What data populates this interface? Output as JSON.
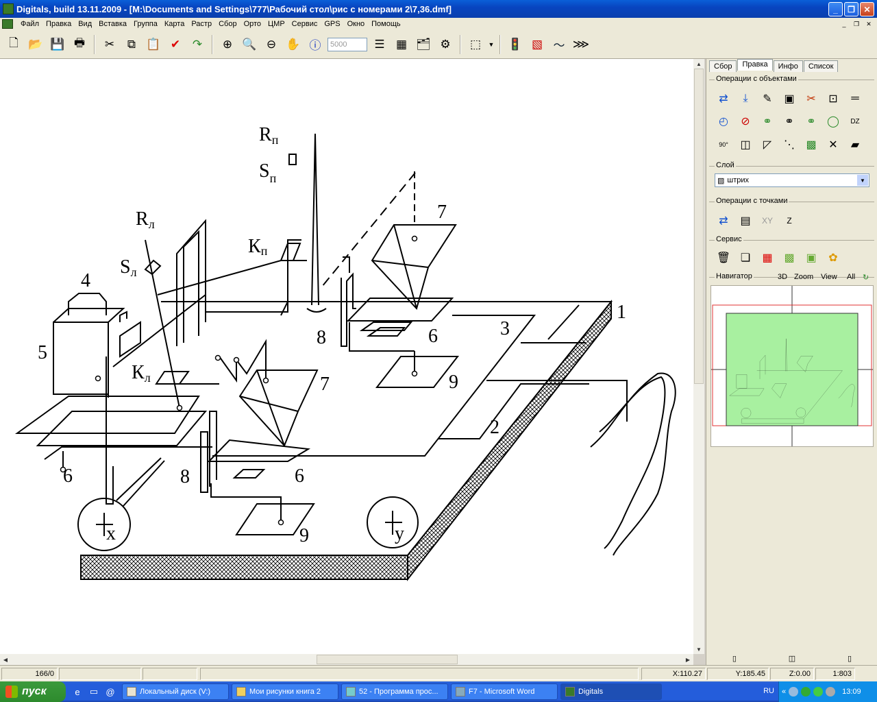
{
  "window": {
    "title": "Digitals, build 13.11.2009 - [M:\\Documents and Settings\\777\\Рабочий стол\\рис с номерами 2\\7,36.dmf]"
  },
  "menu": [
    "Файл",
    "Правка",
    "Вид",
    "Вставка",
    "Группа",
    "Карта",
    "Растр",
    "Сбор",
    "Орто",
    "ЦМР",
    "Сервис",
    "GPS",
    "Окно",
    "Помощь"
  ],
  "toolbar": {
    "scale_placeholder": "5000"
  },
  "drawing": {
    "labels": {
      "rp": "R",
      "rp_sub": "п",
      "sp": "S",
      "sp_sub": "п",
      "kp": "К",
      "kp_sub": "п",
      "rl": "R",
      "rl_sub": "л",
      "sl": "S",
      "sl_sub": "л",
      "kl": "К",
      "kl_sub": "л",
      "n1": "1",
      "n2": "2",
      "n3": "3",
      "n4": "4",
      "n5": "5",
      "n6a": "6",
      "n6b": "6",
      "n6c": "6",
      "n7a": "7",
      "n7b": "7",
      "n8a": "8",
      "n8b": "8",
      "n9a": "9",
      "n9b": "9",
      "x": "x",
      "y": "y"
    }
  },
  "panel": {
    "tabs": [
      "Сбор",
      "Правка",
      "Инфо",
      "Список"
    ],
    "active_tab": "Правка",
    "group_objects": "Операции с объектами",
    "group_layer": "Слой",
    "layer_value": "штрих",
    "group_points": "Операции с точками",
    "points_xy": "XY",
    "points_z": "Z",
    "group_service": "Сервис",
    "navigator": "Навигатор",
    "nav_3d": "3D",
    "nav_zoom": "Zoom",
    "nav_view": "View",
    "nav_all": "All"
  },
  "status": {
    "count": "166/0",
    "x": "X:110.27",
    "y": "Y:185.45",
    "z": "Z:0.00",
    "scale": "1:803"
  },
  "taskbar": {
    "start": "пуск",
    "tasks": [
      "Локальный диск (V:)",
      "Мои рисунки книга 2",
      "52 - Программа прос...",
      "F7 - Microsoft Word",
      "Digitals"
    ],
    "lang": "RU",
    "time": "13:09"
  }
}
